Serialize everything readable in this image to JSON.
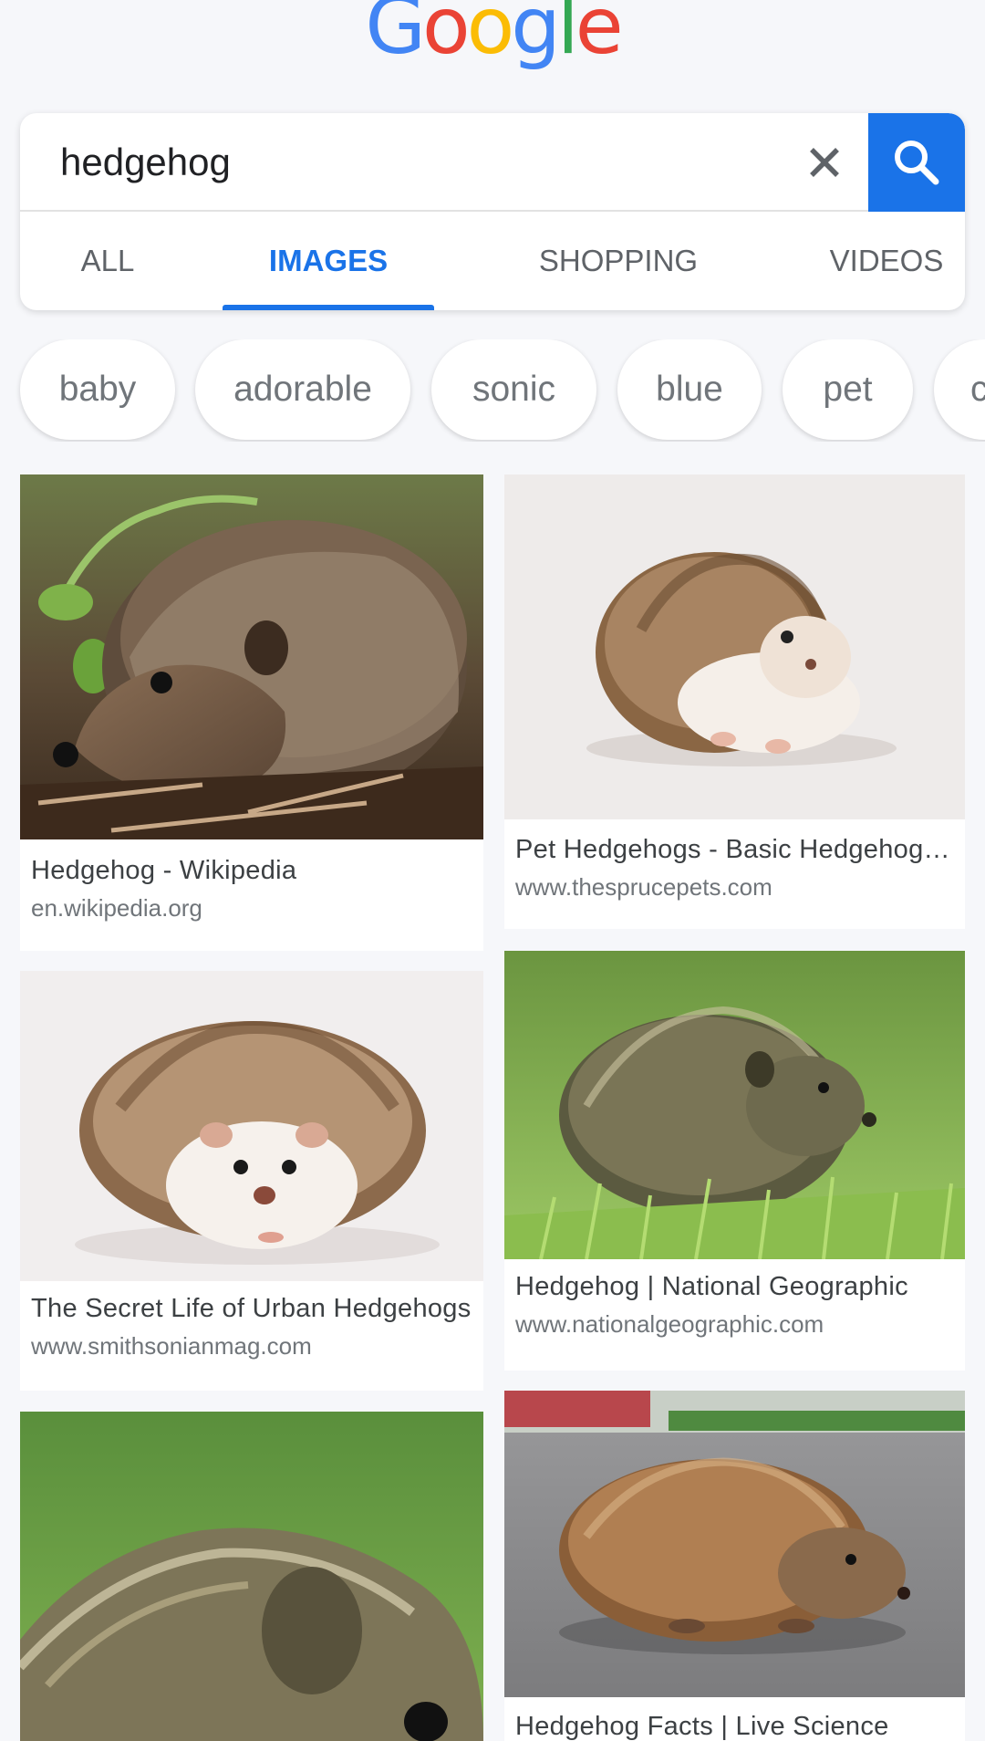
{
  "logo": {
    "letters": [
      "G",
      "o",
      "o",
      "g",
      "l",
      "e"
    ],
    "colors": [
      "#4285f4",
      "#ea4335",
      "#fbbc05",
      "#4285f4",
      "#34a853",
      "#ea4335"
    ]
  },
  "search": {
    "query": "hedgehog",
    "clear_icon": "close-icon",
    "submit_icon": "search-icon"
  },
  "tabs": [
    {
      "label": "ALL",
      "active": false
    },
    {
      "label": "IMAGES",
      "active": true
    },
    {
      "label": "SHOPPING",
      "active": false
    },
    {
      "label": "VIDEOS",
      "active": false
    }
  ],
  "chips": [
    "baby",
    "adorable",
    "sonic",
    "blue",
    "pet",
    "c"
  ],
  "results": [
    {
      "title": "Hedgehog - Wikipedia",
      "domain": "en.wikipedia.org",
      "image": "hedgehog-on-leaves"
    },
    {
      "title": "Pet Hedgehogs - Basic Hedgehog Care",
      "domain": "www.thesprucepets.com",
      "image": "pet-hedgehog-white-background"
    },
    {
      "title": "The Secret Life of Urban Hedgehogs",
      "domain": "www.smithsonianmag.com",
      "image": "hedgehog-white-background-front"
    },
    {
      "title": "Hedgehog | National Geographic",
      "domain": "www.nationalgeographic.com",
      "image": "hedgehog-in-grass"
    },
    {
      "title": "",
      "domain": "",
      "image": "hedgehog-closeup-green-background"
    },
    {
      "title": "Hedgehog Facts | Live Science",
      "domain": "",
      "image": "hedgehog-on-pavement"
    }
  ],
  "colors": {
    "accent": "#1a73e8",
    "tab_inactive": "#5f6368",
    "page_bg": "#f6f7fa"
  }
}
